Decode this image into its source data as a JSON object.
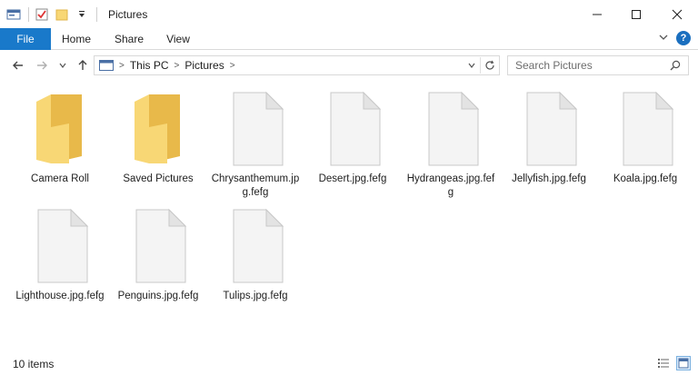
{
  "window": {
    "title": "Pictures",
    "minimize_glyph": "—",
    "maximize_glyph": "☐",
    "close_glyph": "✕"
  },
  "ribbon": {
    "tabs": [
      "File",
      "Home",
      "Share",
      "View"
    ],
    "collapse_glyph": "⌄",
    "help_glyph": "?"
  },
  "nav": {
    "back_icon": "arrow-left-icon",
    "forward_icon": "arrow-right-icon",
    "recent_icon": "chevron-down-icon",
    "up_icon": "arrow-up-icon",
    "breadcrumb": [
      "This PC",
      "Pictures"
    ],
    "search_placeholder": "Search Pictures"
  },
  "items": [
    {
      "name": "Camera Roll",
      "type": "folder"
    },
    {
      "name": "Saved Pictures",
      "type": "folder"
    },
    {
      "name": "Chrysanthemum.jpg.fefg",
      "type": "file"
    },
    {
      "name": "Desert.jpg.fefg",
      "type": "file"
    },
    {
      "name": "Hydrangeas.jpg.fefg",
      "type": "file"
    },
    {
      "name": "Jellyfish.jpg.fefg",
      "type": "file"
    },
    {
      "name": "Koala.jpg.fefg",
      "type": "file"
    },
    {
      "name": "Lighthouse.jpg.fefg",
      "type": "file"
    },
    {
      "name": "Penguins.jpg.fefg",
      "type": "file"
    },
    {
      "name": "Tulips.jpg.fefg",
      "type": "file"
    }
  ],
  "status": {
    "item_count": "10 items"
  },
  "colors": {
    "accent": "#1979ca",
    "folder": "#f8d775",
    "folder_dark": "#e8b94a"
  }
}
